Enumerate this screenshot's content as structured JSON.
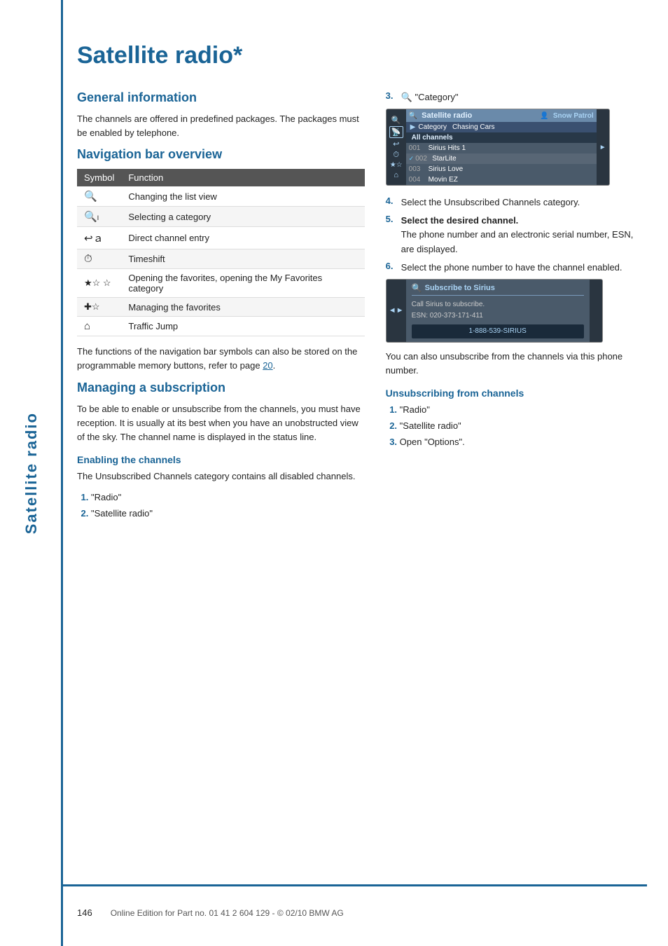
{
  "sidebar": {
    "title": "Satellite radio",
    "label": "Satellite radio"
  },
  "page": {
    "title": "Satellite radio*",
    "sections": {
      "general": {
        "heading": "General information",
        "text": "The channels are offered in predefined packages. The packages must be enabled by telephone."
      },
      "navbar": {
        "heading": "Navigation bar overview",
        "table": {
          "headers": [
            "Symbol",
            "Function"
          ],
          "rows": [
            {
              "symbol": "⟳",
              "function": "Changing the list view",
              "unicode": "🔄"
            },
            {
              "symbol": "⊕",
              "function": "Selecting a category"
            },
            {
              "symbol": "↩",
              "function": "Direct channel entry"
            },
            {
              "symbol": "⏱",
              "function": "Timeshift"
            },
            {
              "symbol": "★☆",
              "function": "Opening the favorites, opening the My Favorites category"
            },
            {
              "symbol": "+☆",
              "function": "Managing the favorites"
            },
            {
              "symbol": "⌂",
              "function": "Traffic Jump"
            }
          ]
        },
        "footer": "The functions of the navigation bar symbols can also be stored on the programmable memory buttons, refer to page 20."
      },
      "managing": {
        "heading": "Managing a subscription",
        "text": "To be able to enable or unsubscribe from the channels, you must have reception. It is usually at its best when you have an unobstructed view of the sky. The channel name is displayed in the status line.",
        "enabling": {
          "heading": "Enabling the channels",
          "text": "The Unsubscribed Channels category contains all disabled channels.",
          "steps": [
            "\"Radio\"",
            "\"Satellite radio\""
          ]
        }
      },
      "right_col": {
        "step3": "\"Category\"",
        "screen1": {
          "title": "Satellite radio",
          "snow_patrol": "Snow Patrol",
          "category_label": "Category",
          "chasing_cars": "Chasing Cars",
          "all_channels": "All channels",
          "channels": [
            {
              "num": "001",
              "name": "Sirius Hits 1",
              "checked": false
            },
            {
              "num": "002",
              "name": "StarLite",
              "checked": true
            },
            {
              "num": "003",
              "name": "Sirius Love",
              "checked": false
            },
            {
              "num": "004",
              "name": "Movin EZ",
              "checked": false
            }
          ]
        },
        "step4": "Select the Unsubscribed Channels category.",
        "step5_title": "Select the desired channel.",
        "step5_body": "The phone number and an electronic serial number, ESN, are displayed.",
        "step6": "Select the phone number to have the channel enabled.",
        "screen2": {
          "title": "Subscribe to Sirius",
          "icon": "⊕",
          "line1": "Call Sirius to subscribe.",
          "line2": "ESN: 020-373-171-411",
          "phone": "1-888-539-SIRIUS"
        },
        "after_screen2": "You can also unsubscribe from the channels via this phone number.",
        "unsubscribing": {
          "heading": "Unsubscribing from channels",
          "steps": [
            "\"Radio\"",
            "\"Satellite radio\"",
            "Open \"Options\"."
          ]
        }
      }
    }
  },
  "footer": {
    "page_number": "146",
    "text": "Online Edition for Part no. 01 41 2 604 129 - © 02/10 BMW AG"
  }
}
